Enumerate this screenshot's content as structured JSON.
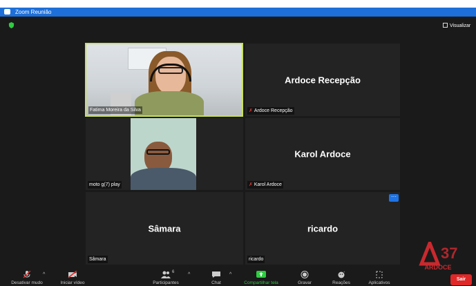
{
  "window": {
    "title": "Zoom Reunião"
  },
  "topbar": {
    "view_label": "Visualizar"
  },
  "tiles": [
    {
      "name": "Fatima Moreira da Silva",
      "display": "",
      "muted": false,
      "has_video": true,
      "active_speaker": true
    },
    {
      "name": "Ardoce Recepção",
      "display": "Ardoce Recepção",
      "muted": true,
      "has_video": false
    },
    {
      "name": "moto g(7) play",
      "display": "",
      "muted": false,
      "has_video": true
    },
    {
      "name": "Karol Ardoce",
      "display": "Karol Ardoce",
      "muted": true,
      "has_video": false
    },
    {
      "name": "Sâmara",
      "display": "Sâmara",
      "muted": false,
      "has_video": false
    },
    {
      "name": "ricardo",
      "display": "ricardo",
      "muted": false,
      "has_video": false
    }
  ],
  "logo": {
    "text": "ARDOCE",
    "number": "37"
  },
  "toolbar": {
    "mute_label": "Desativar mudo",
    "video_label": "Iniciar vídeo",
    "participants_label": "Participantes",
    "participants_count": "6",
    "chat_label": "Chat",
    "share_label": "Compartilhar tela",
    "record_label": "Gravar",
    "reactions_label": "Reações",
    "apps_label": "Aplicativos",
    "leave_label": "Sair"
  },
  "colors": {
    "active_border": "#c8e05c",
    "share_green": "#2ecc40",
    "leave_red": "#e02828",
    "title_blue": "#1e6fd9"
  },
  "icons": [
    "shield-icon",
    "grid-icon",
    "mic-muted-icon",
    "video-off-icon",
    "participants-icon",
    "chat-icon",
    "share-screen-icon",
    "record-icon",
    "reactions-icon",
    "apps-icon",
    "more-icon"
  ]
}
